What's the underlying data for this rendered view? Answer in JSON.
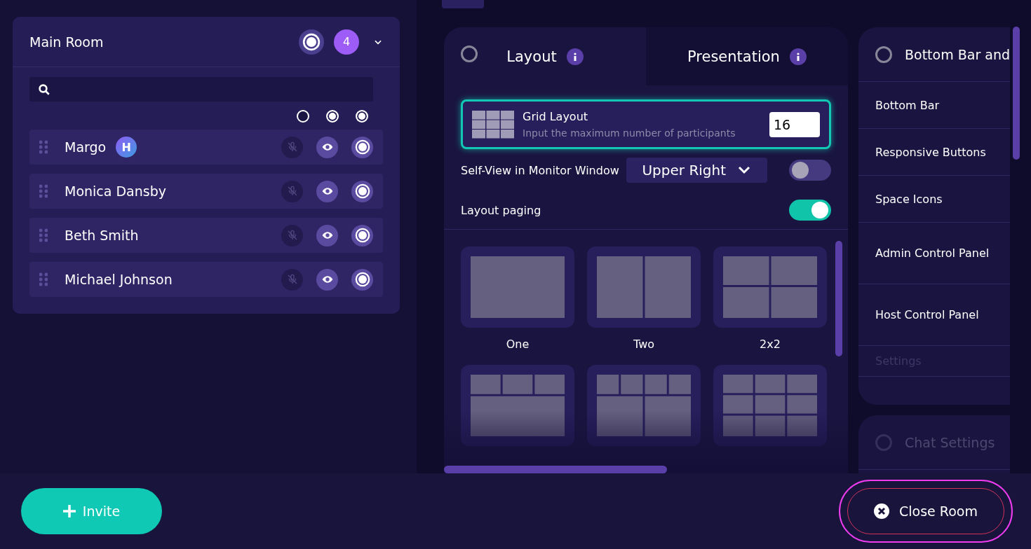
{
  "room": {
    "title": "Main Room",
    "count": "4",
    "expanded": true,
    "column_toggles": [
      {
        "on": false
      },
      {
        "on": true
      },
      {
        "on": true
      }
    ],
    "participants": [
      {
        "name": "Margo",
        "badge": "H",
        "muted": true
      },
      {
        "name": "Monica Dansby",
        "muted": true
      },
      {
        "name": "Beth Smith",
        "muted": true
      },
      {
        "name": "Michael Johnson",
        "muted": true
      }
    ]
  },
  "layout_panel": {
    "tabs": [
      {
        "label": "Layout",
        "selected": true
      },
      {
        "label": "Presentation",
        "selected": false
      }
    ],
    "grid_option": {
      "title": "Grid Layout",
      "hint": "Input the maximum number of participants",
      "value": "16",
      "selected": true
    },
    "self_view": {
      "label": "Self-View in Monitor Window",
      "choice": "Upper Right",
      "on": false
    },
    "paging": {
      "label": "Layout paging",
      "on": true
    },
    "tiles": [
      {
        "kind": "one",
        "label": "One"
      },
      {
        "kind": "two",
        "label": "Two"
      },
      {
        "kind": "quad",
        "label": "2x2"
      },
      {
        "kind": "three-over-one"
      },
      {
        "kind": "four-over-two"
      },
      {
        "kind": "nine"
      }
    ]
  },
  "settings_panel": {
    "title": "Bottom Bar and",
    "items": [
      "Bottom Bar",
      "Responsive Buttons",
      "Space Icons",
      "Admin Control Panel",
      "Host Control Panel",
      "Settings"
    ],
    "next_title": "Chat Settings"
  },
  "footer": {
    "invite": "Invite",
    "close": "Close Room"
  }
}
